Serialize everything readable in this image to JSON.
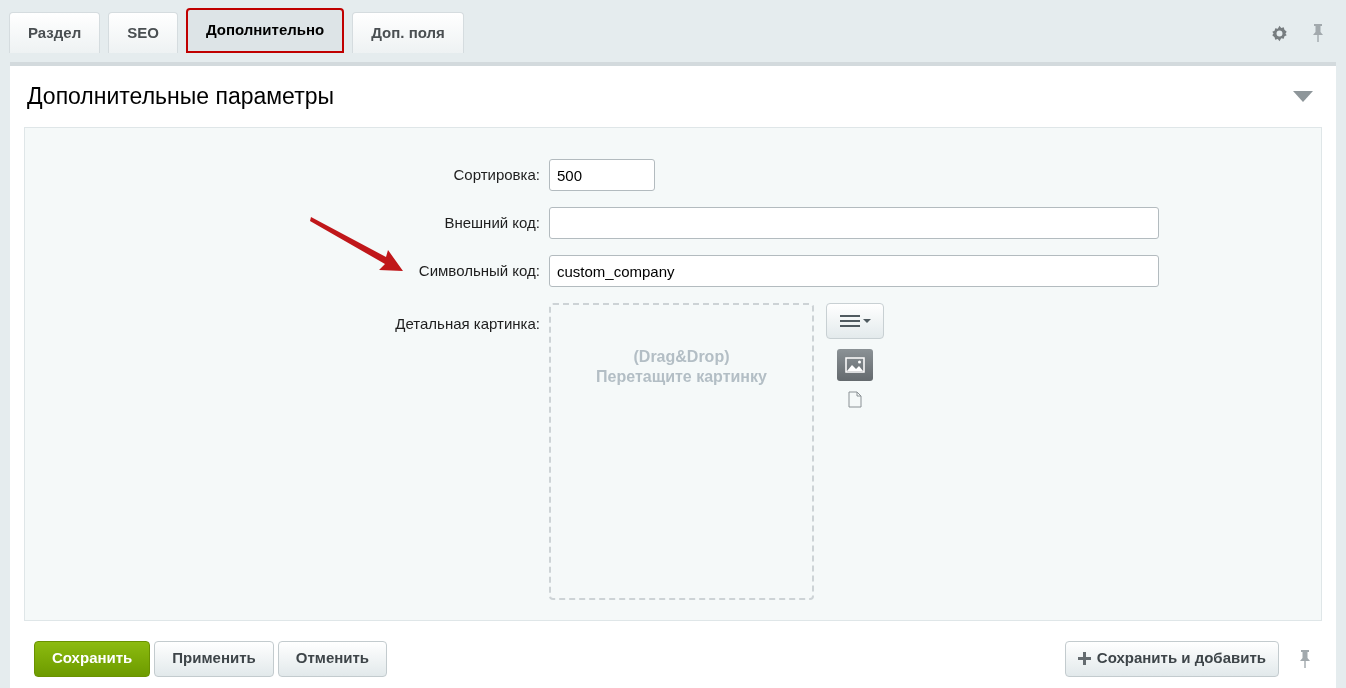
{
  "tabs": [
    {
      "label": "Раздел",
      "selected": false,
      "highlighted": false
    },
    {
      "label": "SEO",
      "selected": false,
      "highlighted": false
    },
    {
      "label": "Дополнительно",
      "selected": true,
      "highlighted": true
    },
    {
      "label": "Доп. поля",
      "selected": false,
      "highlighted": false
    }
  ],
  "section": {
    "title": "Дополнительные параметры",
    "expanded": true
  },
  "fields": [
    {
      "kind": "short",
      "label": "Сортировка:",
      "value": "500"
    },
    {
      "kind": "long",
      "label": "Внешний код:"
    },
    {
      "kind": "long",
      "label": "Символьный код:",
      "value": "custom_company",
      "pointed": true
    },
    {
      "kind": "image",
      "label": "Детальная картинка:",
      "hint_line_1": "(Drag&Drop)",
      "hint_line_2": "Перетащите картинку"
    }
  ],
  "buttons": [
    {
      "label": "Сохранить",
      "kind": "primary"
    },
    {
      "label": "Применить",
      "kind": "default"
    },
    {
      "label": "Отменить",
      "kind": "default"
    },
    {
      "label": "Сохранить и добавить",
      "kind": "add"
    }
  ]
}
